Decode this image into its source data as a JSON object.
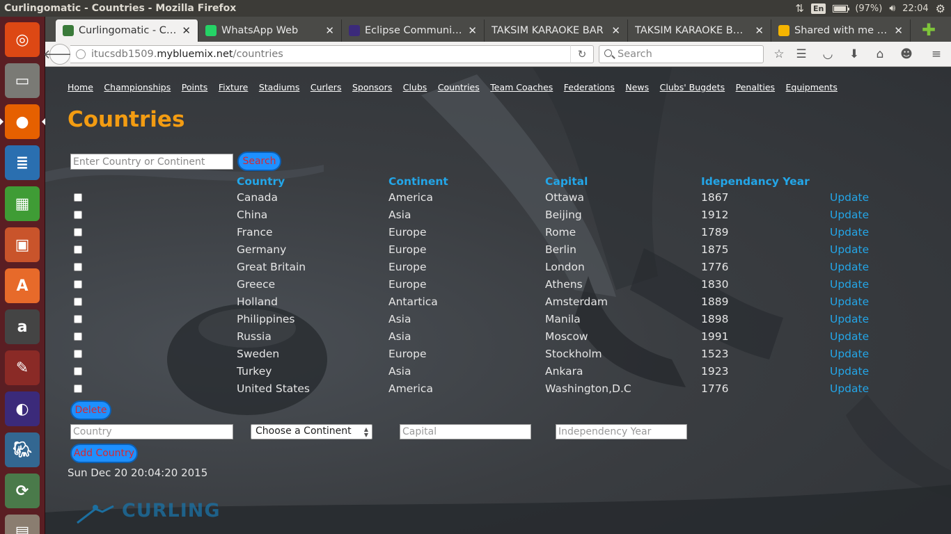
{
  "window": {
    "title": "Curlingomatic - Countries - Mozilla Firefox",
    "keyboard_layout": "En",
    "battery": "(97%)",
    "battery_level": 0.97,
    "clock": "22:04"
  },
  "launcher": {
    "items": [
      {
        "name": "ubuntu-dash-icon",
        "color": "#dd4814"
      },
      {
        "name": "files-icon",
        "color": "#7a7a75"
      },
      {
        "name": "firefox-icon",
        "color": "#e66000"
      },
      {
        "name": "writer-icon",
        "color": "#2a6fb0"
      },
      {
        "name": "calc-icon",
        "color": "#3f9c35"
      },
      {
        "name": "impress-icon",
        "color": "#c9542b"
      },
      {
        "name": "software-center-icon",
        "color": "#e76a2a"
      },
      {
        "name": "amazon-icon",
        "color": "#444444"
      },
      {
        "name": "system-settings-icon",
        "color": "#8a2a26"
      },
      {
        "name": "eclipse-icon",
        "color": "#3b2a7a"
      },
      {
        "name": "postgresql-icon",
        "color": "#336791"
      },
      {
        "name": "software-updater-icon",
        "color": "#4a7a4a"
      },
      {
        "name": "workspace-switcher-icon",
        "color": "#8a7d70"
      }
    ]
  },
  "browser": {
    "tabs": [
      {
        "label": "Curlingomatic - Cou...",
        "fav": "#3a7a3a",
        "active": true
      },
      {
        "label": "WhatsApp Web",
        "fav": "#25d366",
        "active": false
      },
      {
        "label": "Eclipse Community ...",
        "fav": "#3b2a7a",
        "active": false
      },
      {
        "label": "TAKSIM KARAOKE BAR",
        "fav": "",
        "active": false
      },
      {
        "label": "TAKSIM KARAOKE BAR...",
        "fav": "",
        "active": false
      },
      {
        "label": "Shared with me - Go...",
        "fav": "#f4b400",
        "active": false
      }
    ],
    "url_prefix": "itucsdb1509.",
    "url_host": "mybluemix.net",
    "url_path": "/countries",
    "search_placeholder": "Search"
  },
  "page": {
    "nav": [
      "Home",
      "Championships",
      "Points",
      "Fixture",
      "Stadiums",
      "Curlers",
      "Sponsors",
      "Clubs",
      "Countries",
      "Team Coaches",
      "Federations",
      "News",
      "Clubs' Bugdets",
      "Penalties",
      "Equipments"
    ],
    "title": "Countries",
    "search_placeholder": "Enter Country or Continent",
    "search_button": "Search",
    "columns": [
      "Country",
      "Continent",
      "Capital",
      "Idependancy Year"
    ],
    "rows": [
      {
        "country": "Canada",
        "continent": "America",
        "capital": "Ottawa",
        "year": "1867"
      },
      {
        "country": "China",
        "continent": "Asia",
        "capital": "Beijing",
        "year": "1912"
      },
      {
        "country": "France",
        "continent": "Europe",
        "capital": "Rome",
        "year": "1789"
      },
      {
        "country": "Germany",
        "continent": "Europe",
        "capital": "Berlin",
        "year": "1875"
      },
      {
        "country": "Great Britain",
        "continent": "Europe",
        "capital": "London",
        "year": "1776"
      },
      {
        "country": "Greece",
        "continent": "Europe",
        "capital": "Athens",
        "year": "1830"
      },
      {
        "country": "Holland",
        "continent": "Antartica",
        "capital": "Amsterdam",
        "year": "1889"
      },
      {
        "country": "Philippines",
        "continent": "Asia",
        "capital": "Manila",
        "year": "1898"
      },
      {
        "country": "Russia",
        "continent": "Asia",
        "capital": "Moscow",
        "year": "1991"
      },
      {
        "country": "Sweden",
        "continent": "Europe",
        "capital": "Stockholm",
        "year": "1523"
      },
      {
        "country": "Turkey",
        "continent": "Asia",
        "capital": "Ankara",
        "year": "1923"
      },
      {
        "country": "United States",
        "continent": "America",
        "capital": "Washington,D.C",
        "year": "1776"
      }
    ],
    "update_label": "Update",
    "delete_button": "Delete",
    "add_form": {
      "country_placeholder": "Country",
      "continent_select": "Choose a Continent",
      "capital_placeholder": "Capital",
      "year_placeholder": "Independency Year",
      "add_button": "Add Country"
    },
    "timestamp": "Sun Dec 20 20:04:20 2015",
    "logo_text": "CURLING"
  },
  "colors": {
    "title": "#f39c12",
    "header": "#23a6e8",
    "button": "#1e90ff",
    "button_text": "#d9272e"
  }
}
